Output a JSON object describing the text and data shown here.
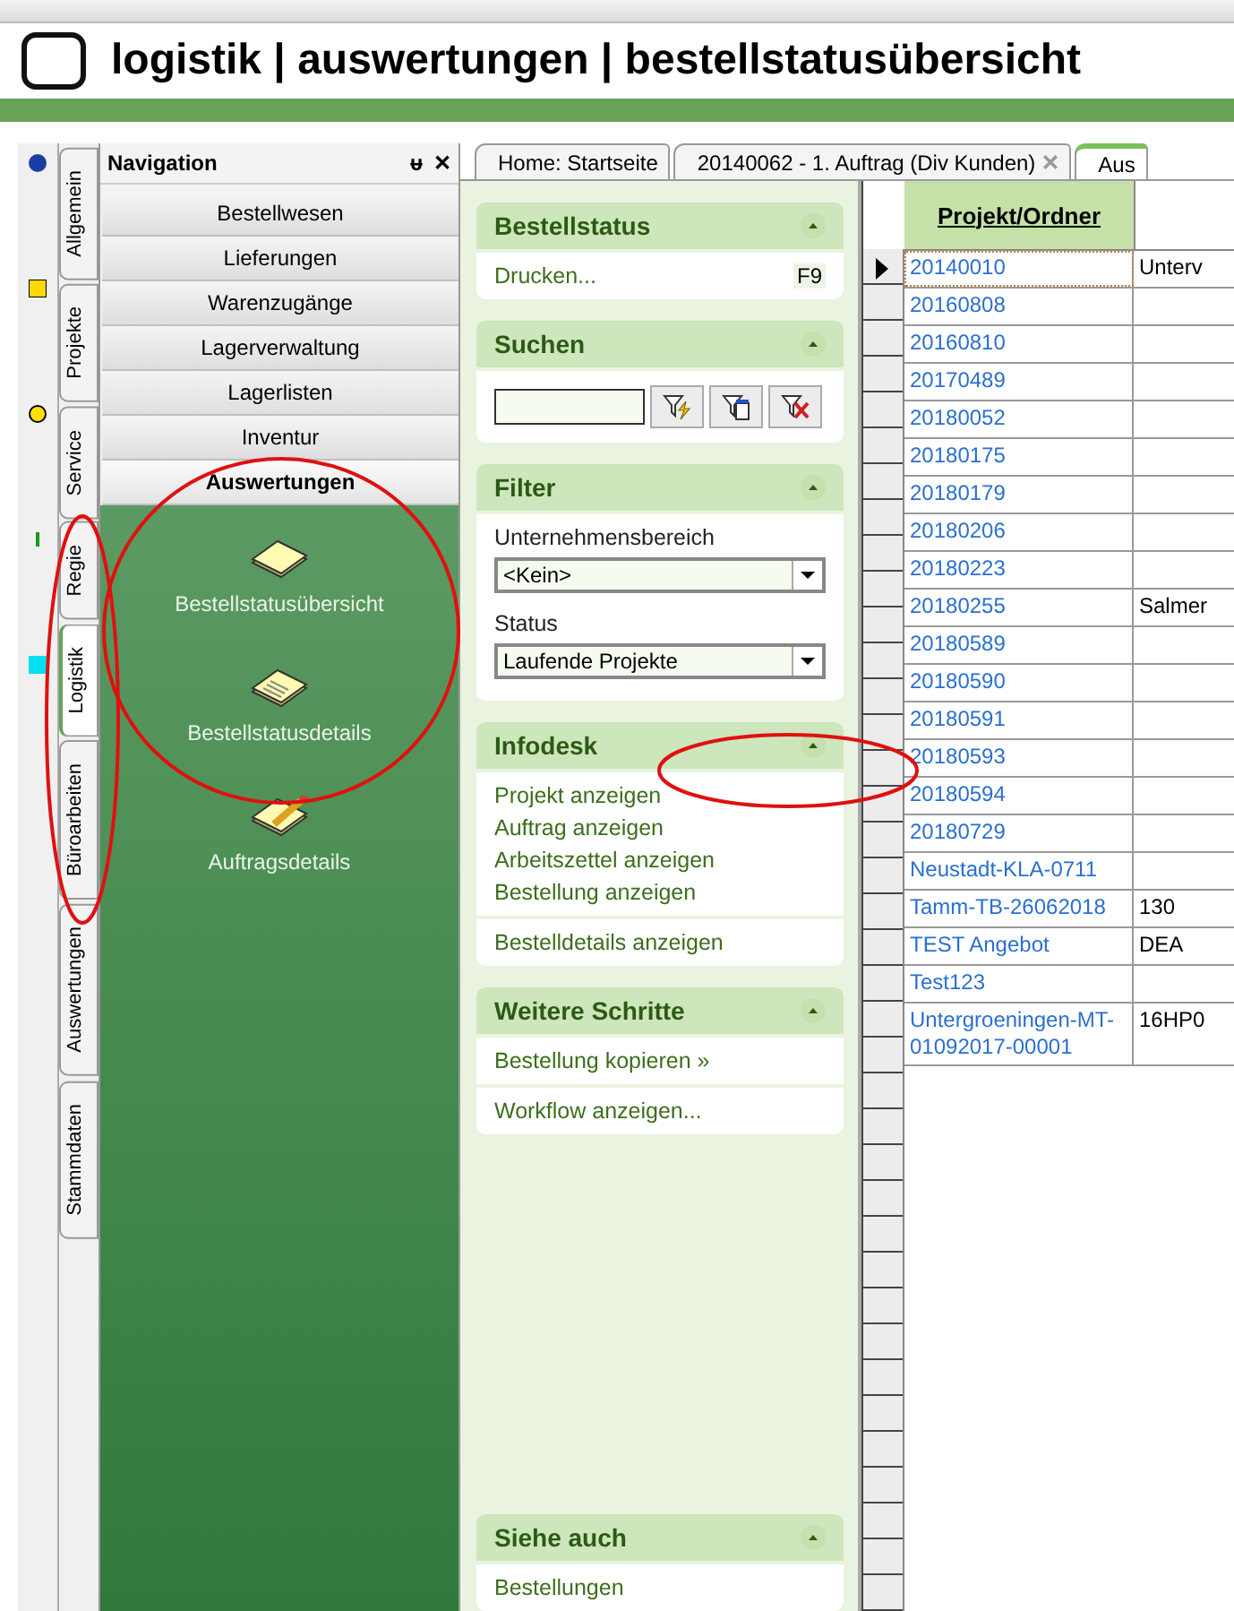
{
  "header": {
    "title": "logistik | auswertungen | bestellstatusübersicht"
  },
  "side_tabs": [
    {
      "label": "Allgemein",
      "selected": false
    },
    {
      "label": "Projekte",
      "selected": false
    },
    {
      "label": "Service",
      "selected": false
    },
    {
      "label": "Regie",
      "selected": false
    },
    {
      "label": "Logistik",
      "selected": true
    },
    {
      "label": "Büroarbeiten",
      "selected": false
    },
    {
      "label": "Auswertungen",
      "selected": false
    },
    {
      "label": "Stammdaten",
      "selected": false
    }
  ],
  "navigation": {
    "title": "Navigation",
    "pin": "ᵾ",
    "close": "✕",
    "groups": [
      {
        "label": "Bestellwesen",
        "selected": false
      },
      {
        "label": "Lieferungen",
        "selected": false
      },
      {
        "label": "Warenzugänge",
        "selected": false
      },
      {
        "label": "Lagerverwaltung",
        "selected": false
      },
      {
        "label": "Lagerlisten",
        "selected": false
      },
      {
        "label": "Inventur",
        "selected": false
      },
      {
        "label": "Auswertungen",
        "selected": true
      }
    ],
    "items": [
      {
        "label": "Bestellstatusübersicht",
        "kind": "blank"
      },
      {
        "label": "Bestellstatusdetails",
        "kind": "lined"
      },
      {
        "label": "Auftragsdetails",
        "kind": "pencil"
      }
    ]
  },
  "doc_tabs": [
    {
      "label": "Home: Startseite",
      "selected": false,
      "closable": false
    },
    {
      "label": "20140062 - 1. Auftrag (Div Kunden)",
      "selected": false,
      "closable": true
    },
    {
      "label": "Aus",
      "selected": true,
      "closable": false
    }
  ],
  "task_pane": {
    "sections": [
      {
        "title": "Bestellstatus",
        "kind": "links",
        "groups": [
          [
            {
              "label": "Drucken...",
              "shortcut": "F9"
            }
          ]
        ]
      },
      {
        "title": "Suchen",
        "kind": "search"
      },
      {
        "title": "Filter",
        "kind": "filter",
        "fields": [
          {
            "label": "Unternehmensbereich",
            "value": "<Kein>"
          },
          {
            "label": "Status",
            "value": "Laufende Projekte"
          }
        ]
      },
      {
        "title": "Infodesk",
        "kind": "links",
        "groups": [
          [
            {
              "label": "Projekt anzeigen"
            },
            {
              "label": "Auftrag anzeigen"
            },
            {
              "label": "Arbeitszettel anzeigen"
            },
            {
              "label": "Bestellung anzeigen"
            }
          ],
          [
            {
              "label": "Bestelldetails anzeigen"
            }
          ]
        ]
      },
      {
        "title": "Weitere Schritte",
        "kind": "links",
        "groups": [
          [
            {
              "label": "Bestellung kopieren »"
            }
          ],
          [
            {
              "label": "Workflow anzeigen..."
            }
          ]
        ]
      },
      {
        "title": "Siehe auch",
        "kind": "links",
        "groups": [
          [
            {
              "label": "Bestellungen"
            }
          ]
        ]
      }
    ]
  },
  "grid": {
    "columns": [
      "Projekt/Ordner"
    ],
    "rows": [
      {
        "cells": [
          "20140010",
          "Unterv"
        ],
        "selected": true
      },
      {
        "cells": [
          "20160808"
        ],
        "selected": false
      },
      {
        "cells": [
          "20160810"
        ],
        "selected": false
      },
      {
        "cells": [
          "20170489"
        ],
        "selected": false
      },
      {
        "cells": [
          "20180052"
        ],
        "selected": false
      },
      {
        "cells": [
          "20180175"
        ],
        "selected": false
      },
      {
        "cells": [
          "20180179"
        ],
        "selected": false
      },
      {
        "cells": [
          "20180206"
        ],
        "selected": false
      },
      {
        "cells": [
          "20180223"
        ],
        "selected": false
      },
      {
        "cells": [
          "20180255",
          "Salmer"
        ],
        "selected": false
      },
      {
        "cells": [
          "20180589"
        ],
        "selected": false
      },
      {
        "cells": [
          "20180590"
        ],
        "selected": false
      },
      {
        "cells": [
          "20180591"
        ],
        "selected": false
      },
      {
        "cells": [
          "20180593"
        ],
        "selected": false
      },
      {
        "cells": [
          "20180594"
        ],
        "selected": false
      },
      {
        "cells": [
          "20180729"
        ],
        "selected": false
      },
      {
        "cells": [
          "Neustadt-KLA-0711"
        ],
        "selected": false
      },
      {
        "cells": [
          "Tamm-TB-26062018",
          "130"
        ],
        "selected": false
      },
      {
        "cells": [
          "TEST Angebot",
          "DEA"
        ],
        "selected": false
      },
      {
        "cells": [
          "Test123"
        ],
        "selected": false
      },
      {
        "cells": [
          "Untergroeningen-MT-01092017-00001",
          "16HP0"
        ],
        "selected": false
      }
    ]
  }
}
